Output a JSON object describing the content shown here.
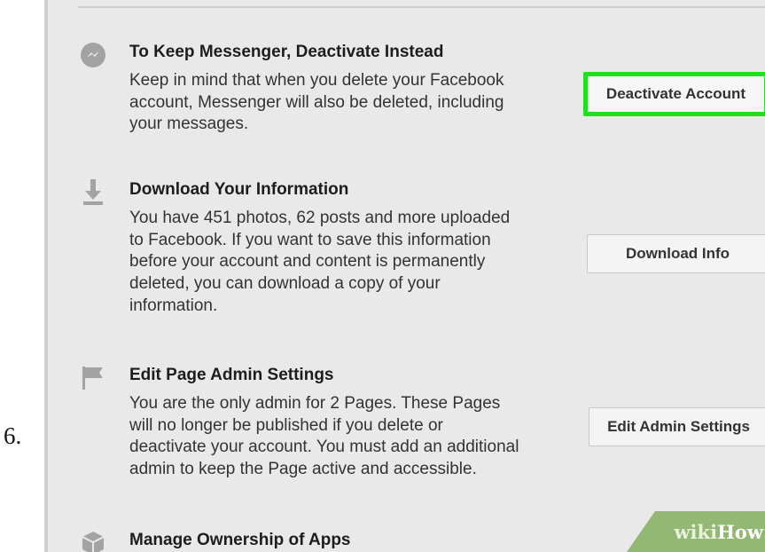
{
  "step_number": "6.",
  "sections": [
    {
      "title": "To Keep Messenger, Deactivate Instead",
      "lines": [
        "Keep in mind that when you delete your Facebook",
        "account, Messenger will also be deleted, including",
        "your messages."
      ],
      "button_label": "Deactivate Account",
      "icon": "messenger-icon"
    },
    {
      "title": "Download Your Information",
      "lines": [
        "You have 451 photos, 62 posts and more uploaded",
        "to Facebook. If you want to save this information",
        "before your account and content is permanently",
        "deleted, you can download a copy of your",
        "information."
      ],
      "button_label": "Download Info",
      "icon": "download-icon"
    },
    {
      "title": "Edit Page Admin Settings",
      "lines": [
        "You are the only admin for 2 Pages. These Pages",
        "will no longer be published if you delete or",
        "deactivate your account. You must add an additional",
        "admin to keep the Page active and accessible."
      ],
      "button_label": "Edit Admin Settings",
      "icon": "flag-icon"
    },
    {
      "title": "Manage Ownership of Apps",
      "icon": "cube-icon"
    }
  ],
  "watermark": {
    "part1": "wiki",
    "part2": "How"
  },
  "colors": {
    "highlight": "#1ee01e",
    "panel": "#e9e9e9",
    "badge": "#93b874"
  }
}
